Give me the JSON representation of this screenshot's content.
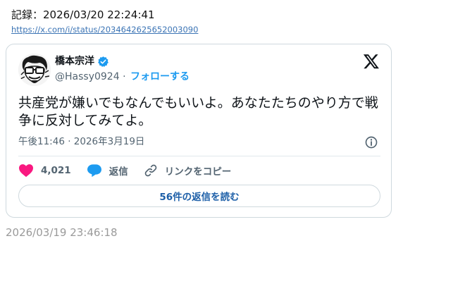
{
  "record": {
    "label": "記録：2026/03/20 22:24:41",
    "url": "https://x.com/i/status/2034642625652003090"
  },
  "tweet": {
    "author_name": "橋本宗洋",
    "handle": "@Hassy0924",
    "separator": "·",
    "follow_label": "フォローする",
    "text": "共産党が嫌いでもなんでもいいよ。あなたたちのやり方で戦争に反対してみてよ。",
    "timestamp": "午後11:46 · 2026年3月19日",
    "likes": "4,021",
    "reply_label": "返信",
    "copy_link_label": "リンクをコピー",
    "read_replies_label": "56件の返信を読む",
    "icons": {
      "logo": "x-logo-icon",
      "verified": "verified-badge-icon",
      "info": "info-icon",
      "like": "heart-icon",
      "reply": "speech-bubble-icon",
      "link": "link-icon"
    },
    "colors": {
      "like": "#f91880",
      "reply": "#1d9bf0",
      "follow": "#1d9bf0",
      "verified": "#1d9bf0"
    }
  },
  "footer": {
    "date": "2026/03/19 23:46:18"
  }
}
